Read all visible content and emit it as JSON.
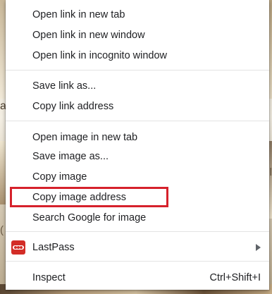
{
  "background": {
    "edge_text_left": "a",
    "edge_text_left_lower": "(",
    "edge_text_right": "l"
  },
  "menu": {
    "groups": [
      [
        "Open link in new tab",
        "Open link in new window",
        "Open link in incognito window"
      ],
      [
        "Save link as...",
        "Copy link address"
      ],
      [
        "Open image in new tab",
        "Save image as...",
        "Copy image",
        "Copy image address",
        "Search Google for image"
      ]
    ],
    "open_link_new_tab": "Open link in new tab",
    "open_link_new_window": "Open link in new window",
    "open_link_incognito": "Open link in incognito window",
    "save_link_as": "Save link as...",
    "copy_link_address": "Copy link address",
    "open_image_new_tab": "Open image in new tab",
    "save_image_as": "Save image as...",
    "copy_image": "Copy image",
    "copy_image_address": "Copy image address",
    "search_google_image": "Search Google for image",
    "lastpass": {
      "label": "LastPass",
      "icon": "lastpass-icon",
      "has_submenu": true
    },
    "inspect": {
      "label": "Inspect",
      "shortcut": "Ctrl+Shift+I"
    },
    "highlighted_item": "Copy image address",
    "highlight_color": "#d6212b"
  }
}
